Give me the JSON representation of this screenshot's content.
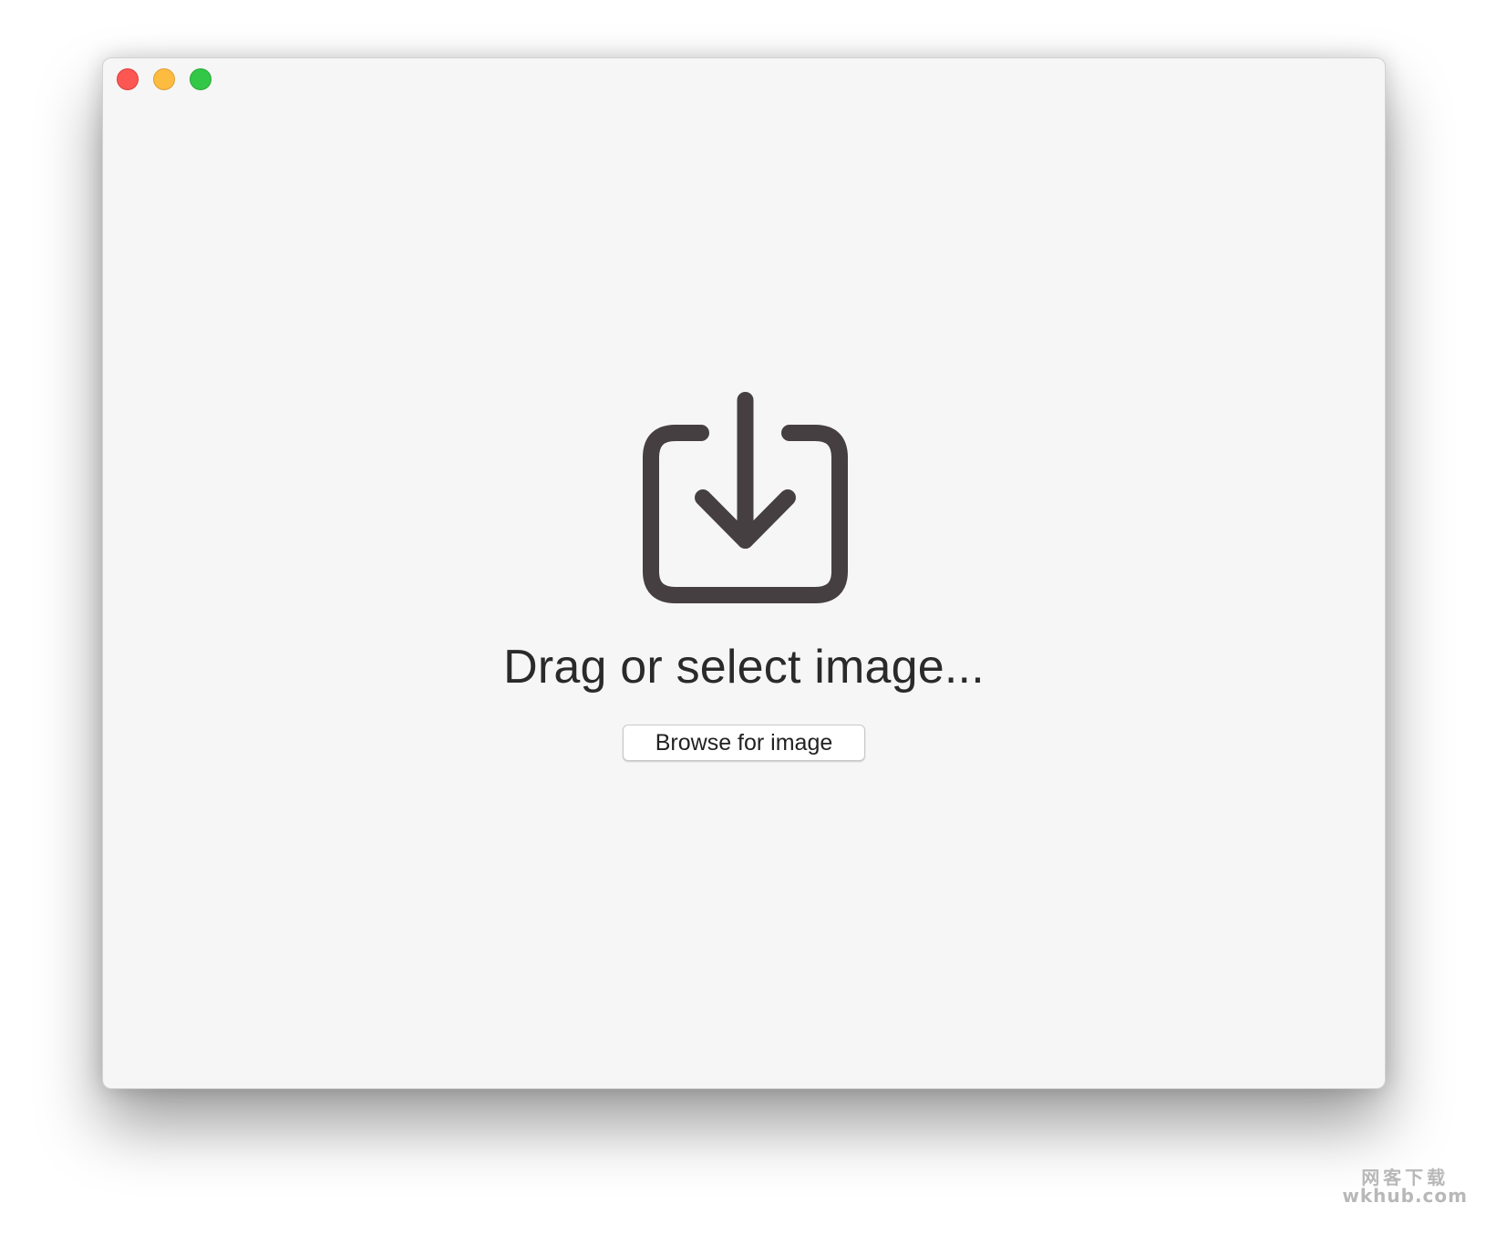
{
  "window": {
    "controls": {
      "close_icon": "close-icon",
      "minimize_icon": "minimize-icon",
      "zoom_icon": "zoom-icon",
      "colors": {
        "close": "#fc5753",
        "minimize": "#fdbc40",
        "zoom": "#33c748"
      }
    }
  },
  "dropzone": {
    "icon": "import-download-icon",
    "icon_color": "#463f41",
    "heading": "Drag or select image...",
    "browse_label": "Browse for image"
  },
  "watermark": {
    "line1": "网客下载",
    "line2": "wkhub.com"
  }
}
